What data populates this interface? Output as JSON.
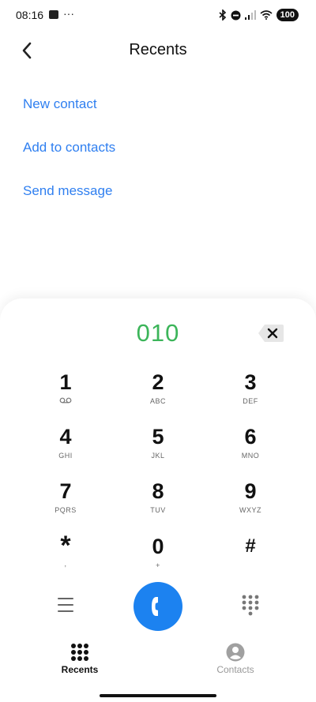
{
  "status_bar": {
    "time": "08:16",
    "overflow": "···",
    "battery": "100",
    "icons": [
      "bluetooth-icon",
      "do-not-disturb-icon",
      "signal-icon",
      "wifi-icon"
    ]
  },
  "header": {
    "title": "Recents",
    "back_icon": "chevron-left-icon"
  },
  "actions": [
    {
      "label": "New contact"
    },
    {
      "label": "Add to contacts"
    },
    {
      "label": "Send message"
    }
  ],
  "dialer": {
    "number": "010",
    "backspace_icon": "backspace-icon",
    "keys": [
      {
        "digit": "1",
        "letters": ""
      },
      {
        "digit": "2",
        "letters": "ABC"
      },
      {
        "digit": "3",
        "letters": "DEF"
      },
      {
        "digit": "4",
        "letters": "GHI"
      },
      {
        "digit": "5",
        "letters": "JKL"
      },
      {
        "digit": "6",
        "letters": "MNO"
      },
      {
        "digit": "7",
        "letters": "PQRS"
      },
      {
        "digit": "8",
        "letters": "TUV"
      },
      {
        "digit": "9",
        "letters": "WXYZ"
      },
      {
        "digit": "*",
        "letters": ","
      },
      {
        "digit": "0",
        "letters": "+"
      },
      {
        "digit": "#",
        "letters": ""
      }
    ]
  },
  "bottom_nav": {
    "tabs": [
      {
        "label": "Recents",
        "icon": "dialpad-icon",
        "active": true
      },
      {
        "label": "Contacts",
        "icon": "person-icon",
        "active": false
      }
    ]
  },
  "colors": {
    "accent": "#2f7ff0",
    "call": "#1c82f0",
    "number": "#3cb55a"
  }
}
